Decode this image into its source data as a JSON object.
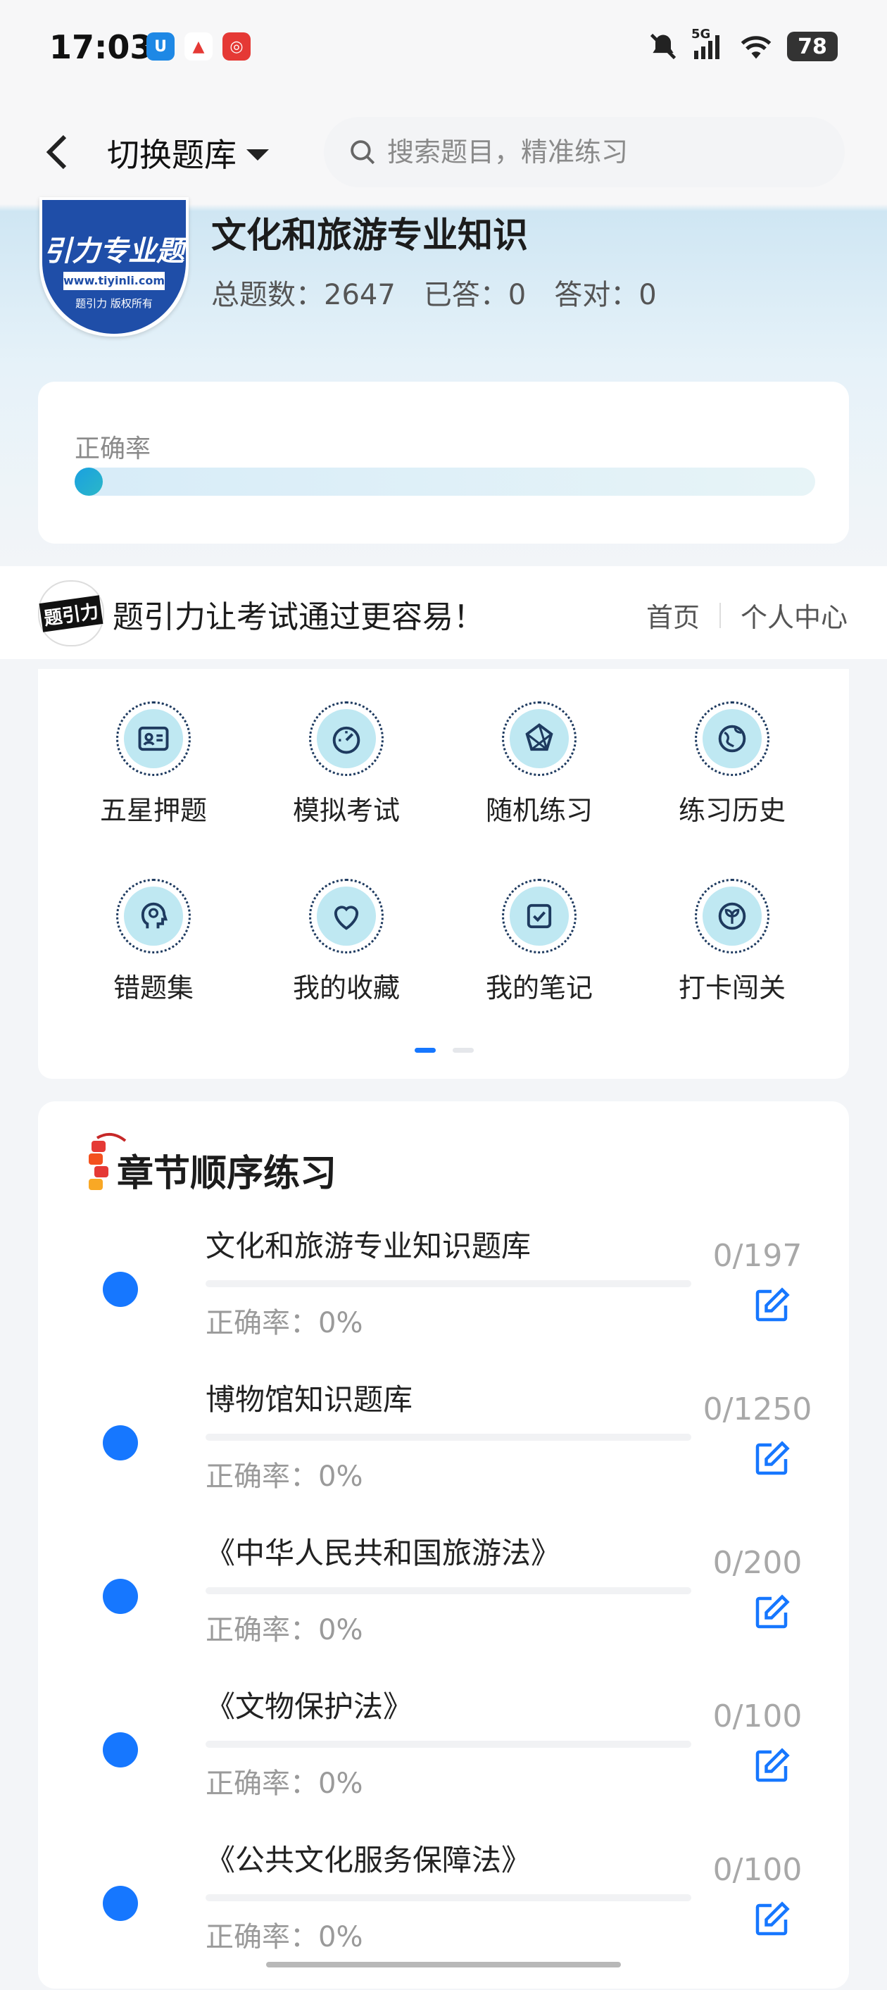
{
  "status_bar": {
    "time": "17:03",
    "network": "5G",
    "battery": "78"
  },
  "header": {
    "switch_label": "切换题库",
    "search_placeholder": "搜索题目，精准练习"
  },
  "bank": {
    "logo_text": "引力专业题",
    "logo_url_text": "www.tiyinli.com",
    "logo_rights_text": "题引力 版权所有",
    "title": "文化和旅游专业知识",
    "total": "总题数：2647",
    "answered": "已答：0",
    "correct": "答对：0",
    "accuracy_label": "正确率",
    "accuracy_value": 0
  },
  "promo": {
    "logo_text": "题引力",
    "slogan": "题引力让考试通过更容易！",
    "link_home": "首页",
    "link_personal": "个人中心"
  },
  "features": [
    {
      "label": "五星押题",
      "icon": "id-card-icon"
    },
    {
      "label": "模拟考试",
      "icon": "gauge-icon"
    },
    {
      "label": "随机练习",
      "icon": "random-icon"
    },
    {
      "label": "练习历史",
      "icon": "globe-icon"
    },
    {
      "label": "错题集",
      "icon": "head-icon"
    },
    {
      "label": "我的收藏",
      "icon": "heart-icon"
    },
    {
      "label": "我的笔记",
      "icon": "note-check-icon"
    },
    {
      "label": "打卡闯关",
      "icon": "sprout-icon"
    }
  ],
  "pager": {
    "active": 0,
    "count": 2
  },
  "chapters": {
    "title": "章节顺序练习",
    "items": [
      {
        "name": "文化和旅游专业知识题库",
        "accuracy": "正确率：0%",
        "count": "0/197"
      },
      {
        "name": "博物馆知识题库",
        "accuracy": "正确率：0%",
        "count": "0/1250"
      },
      {
        "name": "《中华人民共和国旅游法》",
        "accuracy": "正确率：0%",
        "count": "0/200"
      },
      {
        "name": "《文物保护法》",
        "accuracy": "正确率：0%",
        "count": "0/100"
      },
      {
        "name": "《公共文化服务保障法》",
        "accuracy": "正确率：0%",
        "count": "0/100"
      }
    ]
  },
  "colors": {
    "accent": "#1677ff",
    "icon_bg": "#bfe8f2",
    "logo_blue": "#1f4ea8"
  }
}
